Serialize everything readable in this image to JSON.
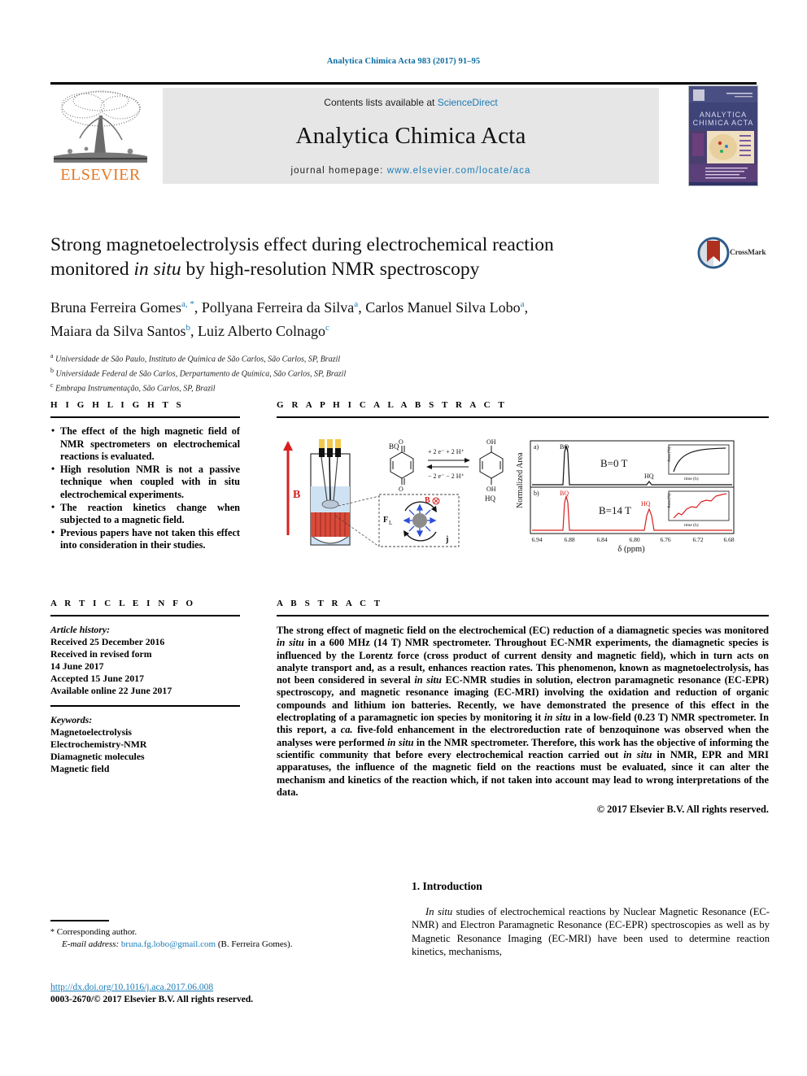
{
  "running_head": "Analytica Chimica Acta 983 (2017) 91–95",
  "masthead": {
    "contents_prefix": "Contents lists available at ",
    "sciencedirect": "ScienceDirect",
    "journal_title": "Analytica Chimica Acta",
    "homepage_prefix": "journal homepage: ",
    "homepage_url": "www.elsevier.com/locate/aca",
    "publisher": "ELSEVIER",
    "link_color": "#1a7cb8",
    "elsevier_orange": "#E87722",
    "band_background": "#e6e6e6"
  },
  "title": {
    "line1": "Strong magnetoelectrolysis effect during electrochemical reaction",
    "line2_pre": "monitored ",
    "line2_italic": "in situ",
    "line2_post": " by high-resolution NMR spectroscopy"
  },
  "crossmark": {
    "label": "CrossMark"
  },
  "authors": [
    {
      "name": "Bruna Ferreira Gomes",
      "marks": "a, *"
    },
    {
      "name": "Pollyana Ferreira da Silva",
      "marks": "a"
    },
    {
      "name": "Carlos Manuel Silva Lobo",
      "marks": "a"
    },
    {
      "name": "Maiara da Silva Santos",
      "marks": "b"
    },
    {
      "name": "Luiz Alberto Colnago",
      "marks": "c"
    }
  ],
  "affiliations": [
    {
      "mark": "a",
      "text": "Universidade de São Paulo, Instituto de Química de São Carlos, São Carlos, SP, Brazil"
    },
    {
      "mark": "b",
      "text": "Universidade Federal de São Carlos, Derpartamento de Química, São Carlos, SP, Brazil"
    },
    {
      "mark": "c",
      "text": "Embrapa Instrumentação, São Carlos, SP, Brazil"
    }
  ],
  "highlights": {
    "heading": "H I G H L I G H T S",
    "items": [
      "The effect of the high magnetic field of NMR spectrometers on electrochemical reactions is evaluated.",
      "High resolution NMR is not a passive technique when coupled with in situ electrochemical experiments.",
      "The reaction kinetics change when subjected to a magnetic field.",
      "Previous papers have not taken this effect into consideration in their studies."
    ]
  },
  "graphical_abstract": {
    "heading": "G R A P H I C A L  A B S T R A C T",
    "field_label": "B",
    "reactant_label": "BQ",
    "product_label": "HQ",
    "forward_reaction": "+ 2 e− + 2 H+",
    "reverse_reaction": "− 2 e− − 2 H+",
    "lorentz_label": "F",
    "lorentz_sub": "L",
    "current_label": "j",
    "inset_field_label": "B",
    "spectra": {
      "ylabel": "Normalized Area",
      "xlabel": "δ (ppm)",
      "xticks": [
        "6.94",
        "6.88",
        "6.84",
        "6.80",
        "6.76",
        "6.72",
        "6.68"
      ],
      "panels": [
        {
          "tag": "a)",
          "condition": "B=0 T",
          "peaks": [
            "BQ",
            "HQ"
          ],
          "color": "#000000"
        },
        {
          "tag": "b)",
          "condition": "B=14 T",
          "peaks": [
            "BQ",
            "HQ"
          ],
          "color": "#d81f1f"
        }
      ],
      "inset_xlabel": "time (h)",
      "inset_ylabel": "Area (%)",
      "inset_xticks": [
        "0",
        "10",
        "20",
        "30"
      ]
    }
  },
  "article_info": {
    "heading": "A R T I C L E  I N F O",
    "history_label": "Article history:",
    "history": [
      "Received 25 December 2016",
      "Received in revised form",
      "14 June 2017",
      "Accepted 15 June 2017",
      "Available online 22 June 2017"
    ],
    "keywords_label": "Keywords:",
    "keywords": [
      "Magnetoelectrolysis",
      "Electrochemistry-NMR",
      "Diamagnetic molecules",
      "Magnetic field"
    ]
  },
  "abstract": {
    "heading": "A B S T R A C T",
    "paragraph_parts": [
      {
        "t": "The strong effect of magnetic field on the electrochemical (EC) reduction of a diamagnetic species was monitored ",
        "i": false
      },
      {
        "t": "in situ",
        "i": true
      },
      {
        "t": " in a 600 MHz (14 T) NMR spectrometer. Throughout EC-NMR experiments, the diamagnetic species is influenced by the Lorentz force (cross product of current density and magnetic field), which in turn acts on analyte transport and, as a result, enhances reaction rates. This phenomenon, known as magnetoelectrolysis, has not been considered in several ",
        "i": false
      },
      {
        "t": "in situ",
        "i": true
      },
      {
        "t": " EC-NMR studies in solution, electron paramagnetic resonance (EC-EPR) spectroscopy, and magnetic resonance imaging (EC-MRI) involving the oxidation and reduction of organic compounds and lithium ion batteries. Recently, we have demonstrated the presence of this effect in the electroplating of a paramagnetic ion species by monitoring it ",
        "i": false
      },
      {
        "t": "in situ",
        "i": true
      },
      {
        "t": " in a low-field (0.23 T) NMR spectrometer. In this report, a ",
        "i": false
      },
      {
        "t": "ca.",
        "i": true
      },
      {
        "t": " five-fold enhancement in the electroreduction rate of benzoquinone was observed when the analyses were performed ",
        "i": false
      },
      {
        "t": "in situ",
        "i": true
      },
      {
        "t": " in the NMR spectrometer. Therefore, this work has the objective of informing the scientific community that before every electrochemical reaction carried out ",
        "i": false
      },
      {
        "t": "in situ",
        "i": true
      },
      {
        "t": " in NMR, EPR and MRI apparatuses, the influence of the magnetic field on the reactions must be evaluated, since it can alter the mechanism and kinetics of the reaction which, if not taken into account may lead to wrong interpretations of the data.",
        "i": false
      }
    ],
    "copyright": "© 2017 Elsevier B.V. All rights reserved."
  },
  "introduction": {
    "heading": "1. Introduction",
    "parts": [
      {
        "t": "In situ",
        "i": true
      },
      {
        "t": " studies of electrochemical reactions by Nuclear Magnetic Resonance (EC-NMR) and Electron Paramagnetic Resonance (EC-EPR) spectroscopies as well as by Magnetic Resonance Imaging (EC-MRI) have been used to determine reaction kinetics, mechanisms,",
        "i": false
      }
    ]
  },
  "footnotes": {
    "corresponding": "Corresponding author.",
    "email_label": "E-mail address:",
    "email": "bruna.fg.lobo@gmail.com",
    "email_owner": "(B. Ferreira Gomes)."
  },
  "footer": {
    "doi": "http://dx.doi.org/10.1016/j.aca.2017.06.008",
    "issn_line": "0003-2670/© 2017 Elsevier B.V. All rights reserved."
  }
}
